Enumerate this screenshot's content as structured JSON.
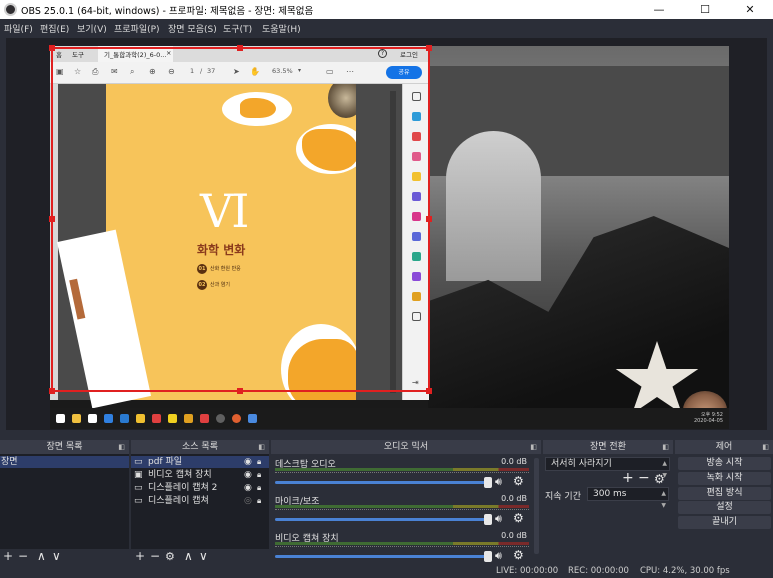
{
  "window": {
    "title": "OBS 25.0.1 (64-bit, windows) - 프로파일: 제목없음 - 장면: 제목없음",
    "minimize": "—",
    "maximize": "☐",
    "close": "✕"
  },
  "menu": [
    "파일(F)",
    "편집(E)",
    "보기(V)",
    "프로파일(P)",
    "장면 모음(S)",
    "도구(T)",
    "도움말(H)"
  ],
  "pdf": {
    "tabs": {
      "home": "홈",
      "tools": "도구",
      "document": "기_통합과학(2)_6-0...",
      "close": "×",
      "login": "로그인",
      "help": "?"
    },
    "toolbar": {
      "page_current": "1",
      "page_sep": "/",
      "page_total": "37",
      "zoom": "63.5%",
      "share": "공유"
    },
    "page": {
      "title_main": "VI",
      "title_sub": "화학 변화",
      "items": [
        {
          "num": "01",
          "text": "산화 환원 반응"
        },
        {
          "num": "02",
          "text": "산과 염기"
        }
      ]
    }
  },
  "desktop": {
    "clock_time": "오후 9:52",
    "clock_date": "2020-04-05"
  },
  "docks": {
    "scenes": {
      "title": "장면 목록",
      "items": [
        "장면"
      ],
      "toolbar": [
        "+",
        "−",
        "∧",
        "∨"
      ]
    },
    "sources": {
      "title": "소스 목록",
      "items": [
        {
          "icon": "image-icon",
          "name": "pdf 파일",
          "visible": true,
          "selected": true
        },
        {
          "icon": "camera-icon",
          "name": "비디오 캡쳐 장치",
          "visible": true,
          "selected": false
        },
        {
          "icon": "monitor-icon",
          "name": "디스플레이 캡쳐 2",
          "visible": true,
          "selected": false
        },
        {
          "icon": "monitor-icon",
          "name": "디스플레이 캡쳐",
          "visible": false,
          "selected": false
        }
      ],
      "toolbar": [
        "+",
        "−",
        "⚙",
        "∧",
        "∨"
      ]
    },
    "mixer": {
      "title": "오디오 믹서",
      "channels": [
        {
          "name": "데스크탑 오디오",
          "db": "0.0 dB",
          "volume": 1.0
        },
        {
          "name": "마이크/보조",
          "db": "0.0 dB",
          "volume": 1.0
        },
        {
          "name": "비디오 캡쳐 장치",
          "db": "0.0 dB",
          "volume": 1.0
        }
      ]
    },
    "transitions": {
      "title": "장면 전환",
      "selected": "서서히 사라지기",
      "duration_label": "지속 기간",
      "duration": "300 ms",
      "add": "+",
      "remove": "−"
    },
    "controls": {
      "title": "제어",
      "buttons": [
        "방송 시작",
        "녹화 시작",
        "편집 방식",
        "설정",
        "끝내기"
      ]
    }
  },
  "status": {
    "live": "LIVE: 00:00:00",
    "rec": "REC: 00:00:00",
    "cpu": "CPU: 4.2%, 30.00 fps"
  },
  "colors": {
    "selection": "#e02020",
    "page_yellow": "#f7c45a",
    "accent_blue": "#1473e6",
    "selected_row": "#2d3d6a"
  }
}
